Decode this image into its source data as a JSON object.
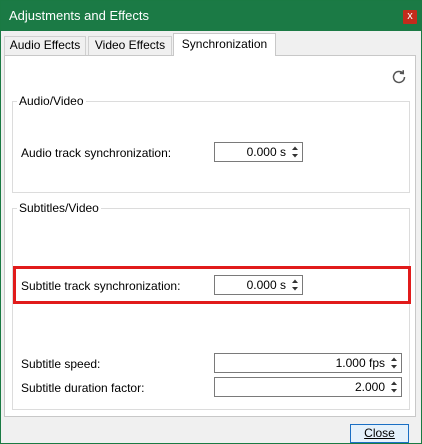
{
  "window": {
    "title": "Adjustments and Effects",
    "close_glyph": "x"
  },
  "tabs": [
    {
      "label": "Audio Effects",
      "active": false
    },
    {
      "label": "Video Effects",
      "active": false
    },
    {
      "label": "Synchronization",
      "active": true
    }
  ],
  "refresh_icon": "refresh-icon",
  "audio_video": {
    "title": "Audio/Video",
    "audio_sync_label": "Audio track synchronization:",
    "audio_sync_value": "0.000 s"
  },
  "subtitles_video": {
    "title": "Subtitles/Video",
    "subtitle_sync_label": "Subtitle track synchronization:",
    "subtitle_sync_value": "0.000 s",
    "subtitle_speed_label": "Subtitle speed:",
    "subtitle_speed_value": "1.000 fps",
    "subtitle_duration_label": "Subtitle duration factor:",
    "subtitle_duration_value": "2.000"
  },
  "footer": {
    "close_label": "Close"
  },
  "colors": {
    "titlebar": "#1b7a45",
    "highlight": "#e11b1b"
  }
}
